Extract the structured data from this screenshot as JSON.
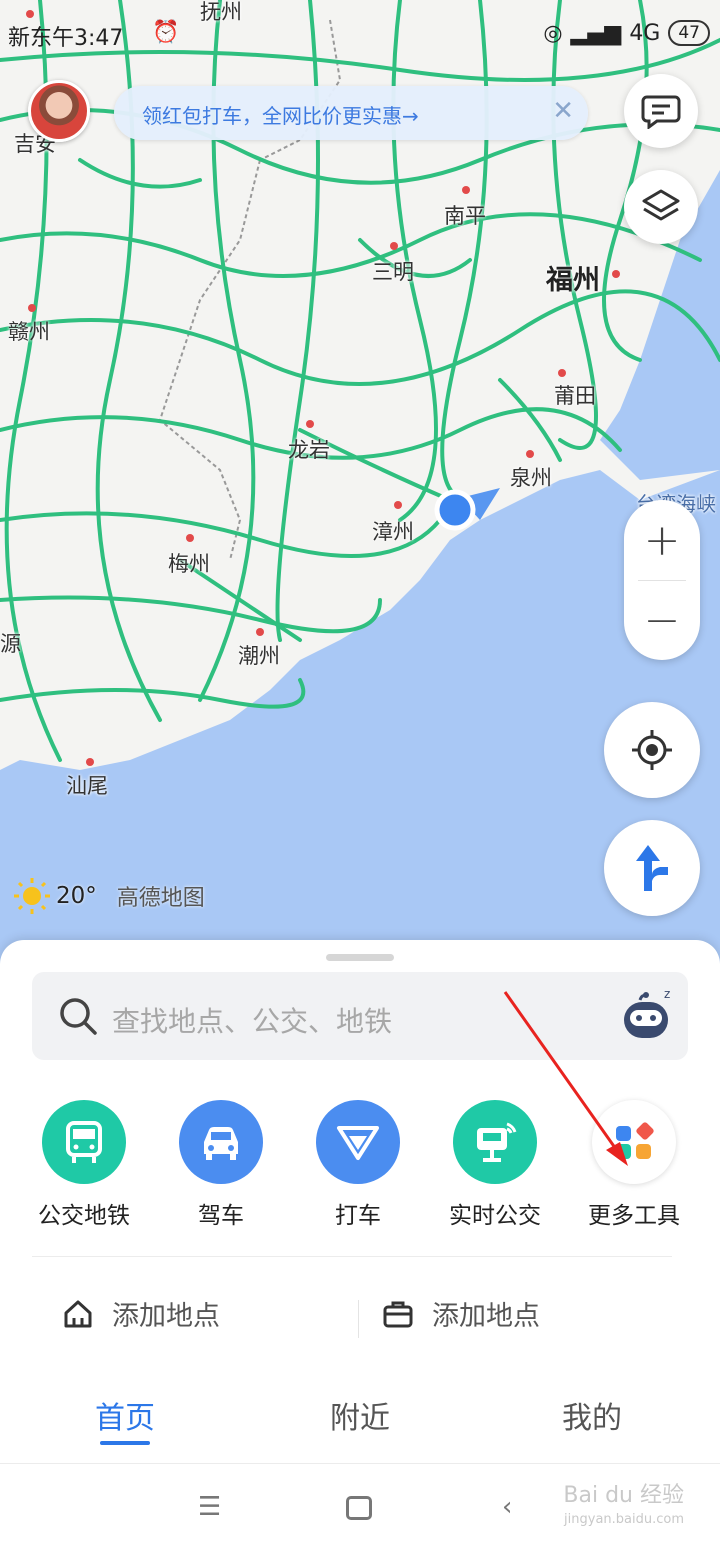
{
  "status_bar": {
    "time": "新东午3:47",
    "network": "4G",
    "battery": "47"
  },
  "promo": {
    "text": "领红包打车，全网比价更实惠→",
    "close": "✕"
  },
  "map": {
    "cities": [
      {
        "name": "抚州"
      },
      {
        "name": "吉安"
      },
      {
        "name": "南平"
      },
      {
        "name": "三明"
      },
      {
        "name": "福州"
      },
      {
        "name": "赣州"
      },
      {
        "name": "莆田"
      },
      {
        "name": "龙岩"
      },
      {
        "name": "泉州"
      },
      {
        "name": "台湾海峡"
      },
      {
        "name": "漳州"
      },
      {
        "name": "梅州"
      },
      {
        "name": "源"
      },
      {
        "name": "潮州"
      },
      {
        "name": "汕尾"
      }
    ],
    "zoom_in": "+",
    "zoom_out": "−"
  },
  "weather": {
    "temperature": "20°",
    "brand": "高德地图"
  },
  "search": {
    "placeholder": "查找地点、公交、地铁"
  },
  "tools": [
    {
      "label": "公交地铁",
      "color": "#1fc9a6",
      "icon": "bus-icon"
    },
    {
      "label": "驾车",
      "color": "#4b8df0",
      "icon": "car-icon"
    },
    {
      "label": "打车",
      "color": "#4b8df0",
      "icon": "taxi-icon"
    },
    {
      "label": "实时公交",
      "color": "#1fc9a6",
      "icon": "realtime-bus-icon"
    },
    {
      "label": "更多工具",
      "color": "#ffffff",
      "icon": "more-tools-icon"
    }
  ],
  "places": {
    "home_label": "添加地点",
    "work_label": "添加地点"
  },
  "tabs": [
    {
      "label": "首页"
    },
    {
      "label": "附近"
    },
    {
      "label": "我的"
    }
  ],
  "watermark": {
    "main": "Bai du 经验",
    "sub": "jingyan.baidu.com"
  },
  "colors": {
    "accent": "#2c77e8",
    "road": "#2fbf7f",
    "sea": "#a9c8f5"
  }
}
